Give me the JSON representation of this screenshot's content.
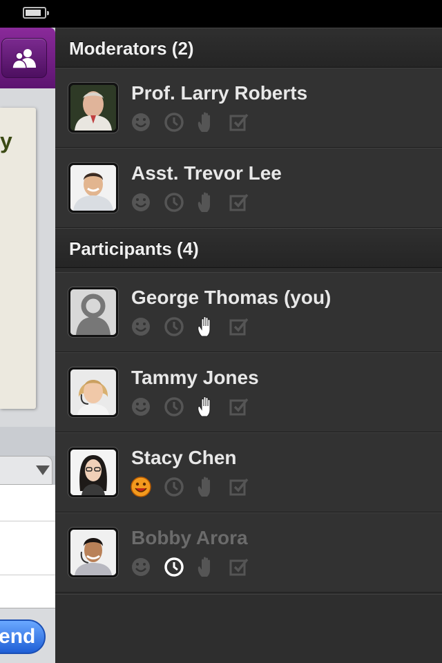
{
  "status_bar": {
    "battery_level": 0.85
  },
  "left_app": {
    "paper_snippet": "y",
    "send_label": "Send",
    "colors": {
      "header": "#6b1c80",
      "send": "#2f6fe0"
    }
  },
  "panel": {
    "sections": {
      "moderators": {
        "title": "Moderators (2)"
      },
      "participants": {
        "title": "Participants (4)"
      }
    },
    "people": [
      {
        "name": "Prof. Larry Roberts",
        "role": "moderator",
        "emoji": false,
        "away": false,
        "hand": false,
        "check": false,
        "dimmed": false
      },
      {
        "name": "Asst. Trevor Lee",
        "role": "moderator",
        "emoji": false,
        "away": false,
        "hand": false,
        "check": false,
        "dimmed": false
      },
      {
        "name": "George Thomas (you)",
        "role": "participant",
        "emoji": false,
        "away": false,
        "hand": true,
        "check": false,
        "dimmed": false
      },
      {
        "name": "Tammy Jones",
        "role": "participant",
        "emoji": false,
        "away": false,
        "hand": true,
        "check": false,
        "dimmed": false
      },
      {
        "name": "Stacy Chen",
        "role": "participant",
        "emoji": true,
        "away": false,
        "hand": false,
        "check": false,
        "dimmed": false
      },
      {
        "name": "Bobby Arora",
        "role": "participant",
        "emoji": false,
        "away": true,
        "hand": false,
        "check": false,
        "dimmed": true
      }
    ],
    "icon_names": [
      "smiley-icon",
      "clock-icon",
      "raise-hand-icon",
      "checkbox-icon"
    ],
    "colors": {
      "active_icon": "#ffffff",
      "inactive_icon": "#555555",
      "emoji_face": "#f39a1e"
    }
  }
}
